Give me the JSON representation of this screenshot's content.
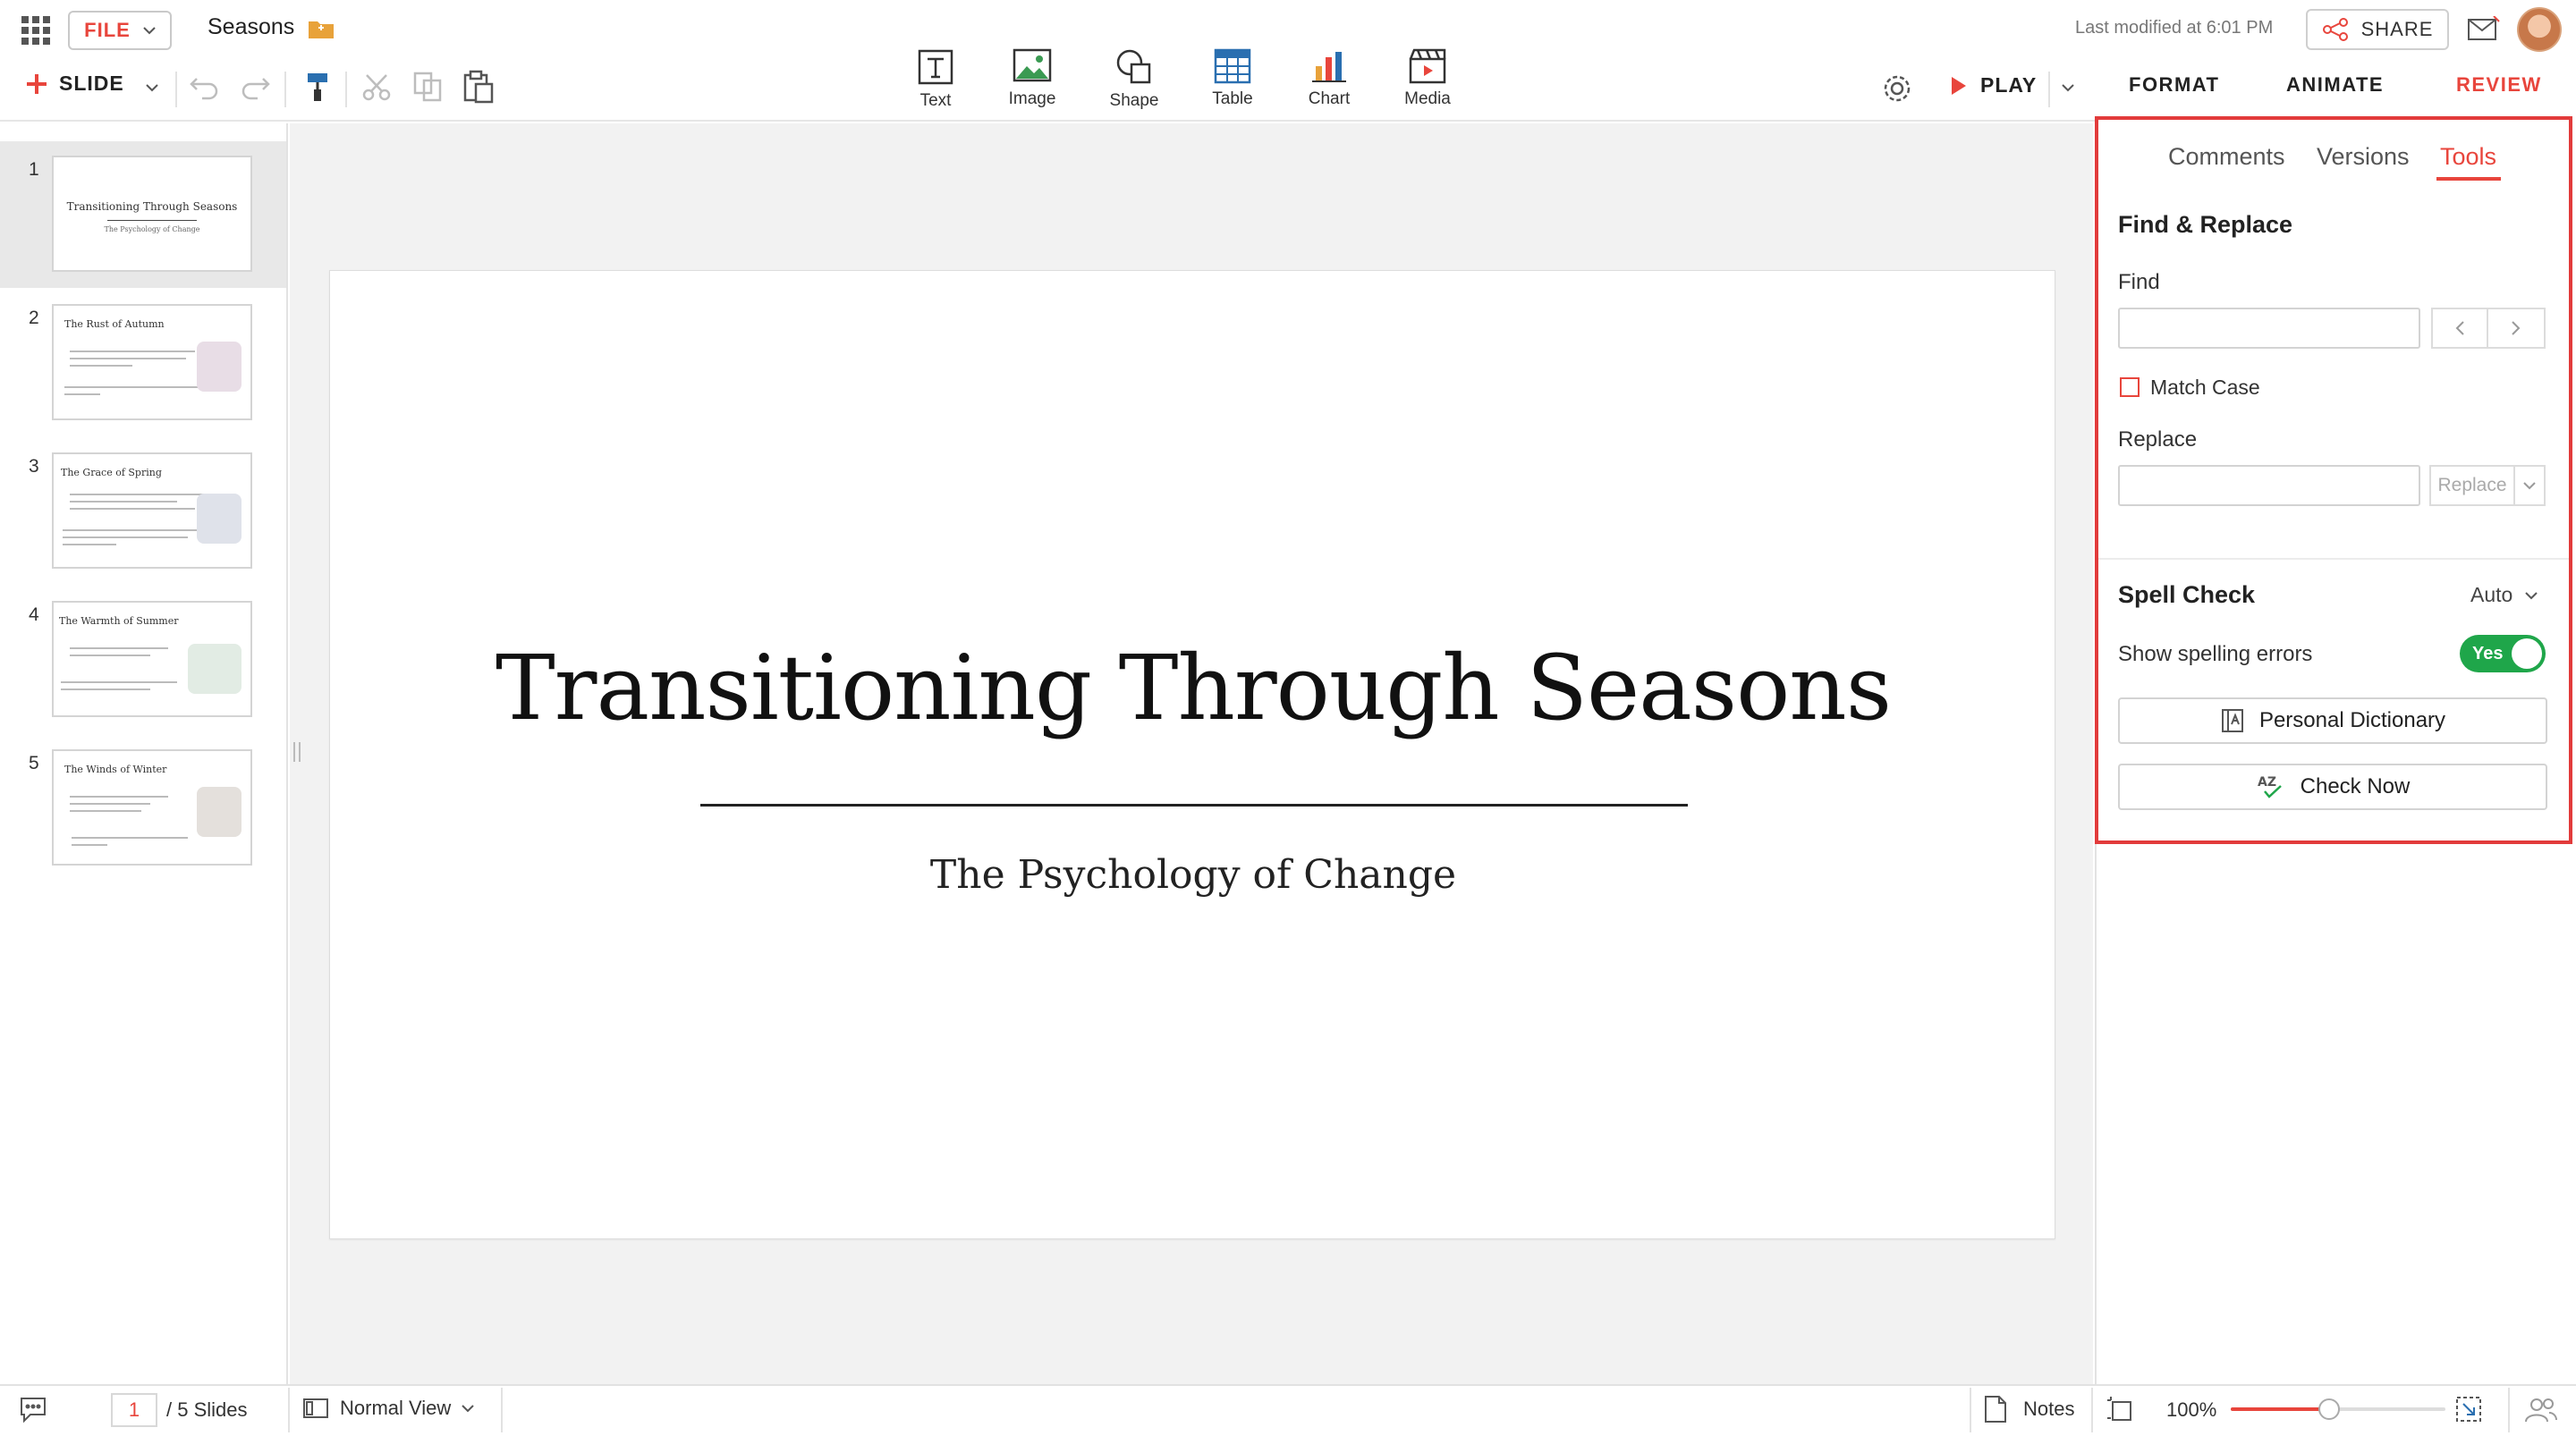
{
  "app": {
    "file_label": "FILE",
    "doc_title": "Seasons",
    "last_modified": "Last modified at 6:01 PM",
    "share_label": "SHARE"
  },
  "toolbar": {
    "slide_label": "SLIDE",
    "play_label": "PLAY",
    "insert_tools": [
      {
        "label": "Text",
        "icon": "text-icon"
      },
      {
        "label": "Image",
        "icon": "image-icon"
      },
      {
        "label": "Shape",
        "icon": "shape-icon"
      },
      {
        "label": "Table",
        "icon": "table-icon"
      },
      {
        "label": "Chart",
        "icon": "chart-icon"
      },
      {
        "label": "Media",
        "icon": "media-icon"
      }
    ],
    "top_tabs": [
      {
        "label": "FORMAT"
      },
      {
        "label": "ANIMATE"
      },
      {
        "label": "REVIEW",
        "active": true
      }
    ]
  },
  "slides": [
    {
      "num": "1",
      "title": "Transitioning Through Seasons",
      "subtitle": "The Psychology of Change",
      "active": true
    },
    {
      "num": "2",
      "title": "The Rust of Autumn"
    },
    {
      "num": "3",
      "title": "The Grace of Spring"
    },
    {
      "num": "4",
      "title": "The Warmth of Summer"
    },
    {
      "num": "5",
      "title": "The Winds of Winter"
    }
  ],
  "current_slide": {
    "title": "Transitioning Through Seasons",
    "subtitle": "The Psychology of Change"
  },
  "review_panel": {
    "subtabs": [
      {
        "label": "Comments"
      },
      {
        "label": "Versions"
      },
      {
        "label": "Tools",
        "active": true
      }
    ],
    "find_replace": {
      "section_title": "Find & Replace",
      "find_label": "Find",
      "find_value": "",
      "match_case_label": "Match Case",
      "match_case_checked": false,
      "replace_label": "Replace",
      "replace_value": "",
      "replace_button": "Replace"
    },
    "spell_check": {
      "section_title": "Spell Check",
      "mode": "Auto",
      "show_errors_label": "Show spelling errors",
      "toggle_label": "Yes",
      "personal_dictionary": "Personal Dictionary",
      "check_now": "Check Now"
    }
  },
  "statusbar": {
    "page_current": "1",
    "page_total": "/ 5 Slides",
    "view_mode": "Normal View",
    "notes_label": "Notes",
    "zoom": "100%",
    "zoom_level": 0.46
  },
  "colors": {
    "accent": "#e8453c",
    "highlight_border": "#e23b3b",
    "toggle_on": "#1fa64a"
  }
}
